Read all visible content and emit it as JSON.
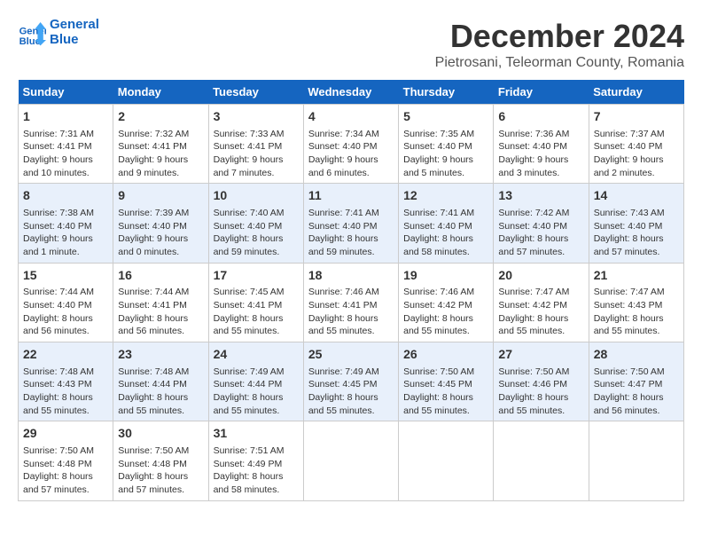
{
  "header": {
    "logo_line1": "General",
    "logo_line2": "Blue",
    "title": "December 2024",
    "subtitle": "Pietrosani, Teleorman County, Romania"
  },
  "weekdays": [
    "Sunday",
    "Monday",
    "Tuesday",
    "Wednesday",
    "Thursday",
    "Friday",
    "Saturday"
  ],
  "weeks": [
    [
      {
        "day": "1",
        "text": "Sunrise: 7:31 AM\nSunset: 4:41 PM\nDaylight: 9 hours and 10 minutes."
      },
      {
        "day": "2",
        "text": "Sunrise: 7:32 AM\nSunset: 4:41 PM\nDaylight: 9 hours and 9 minutes."
      },
      {
        "day": "3",
        "text": "Sunrise: 7:33 AM\nSunset: 4:41 PM\nDaylight: 9 hours and 7 minutes."
      },
      {
        "day": "4",
        "text": "Sunrise: 7:34 AM\nSunset: 4:40 PM\nDaylight: 9 hours and 6 minutes."
      },
      {
        "day": "5",
        "text": "Sunrise: 7:35 AM\nSunset: 4:40 PM\nDaylight: 9 hours and 5 minutes."
      },
      {
        "day": "6",
        "text": "Sunrise: 7:36 AM\nSunset: 4:40 PM\nDaylight: 9 hours and 3 minutes."
      },
      {
        "day": "7",
        "text": "Sunrise: 7:37 AM\nSunset: 4:40 PM\nDaylight: 9 hours and 2 minutes."
      }
    ],
    [
      {
        "day": "8",
        "text": "Sunrise: 7:38 AM\nSunset: 4:40 PM\nDaylight: 9 hours and 1 minute."
      },
      {
        "day": "9",
        "text": "Sunrise: 7:39 AM\nSunset: 4:40 PM\nDaylight: 9 hours and 0 minutes."
      },
      {
        "day": "10",
        "text": "Sunrise: 7:40 AM\nSunset: 4:40 PM\nDaylight: 8 hours and 59 minutes."
      },
      {
        "day": "11",
        "text": "Sunrise: 7:41 AM\nSunset: 4:40 PM\nDaylight: 8 hours and 59 minutes."
      },
      {
        "day": "12",
        "text": "Sunrise: 7:41 AM\nSunset: 4:40 PM\nDaylight: 8 hours and 58 minutes."
      },
      {
        "day": "13",
        "text": "Sunrise: 7:42 AM\nSunset: 4:40 PM\nDaylight: 8 hours and 57 minutes."
      },
      {
        "day": "14",
        "text": "Sunrise: 7:43 AM\nSunset: 4:40 PM\nDaylight: 8 hours and 57 minutes."
      }
    ],
    [
      {
        "day": "15",
        "text": "Sunrise: 7:44 AM\nSunset: 4:40 PM\nDaylight: 8 hours and 56 minutes."
      },
      {
        "day": "16",
        "text": "Sunrise: 7:44 AM\nSunset: 4:41 PM\nDaylight: 8 hours and 56 minutes."
      },
      {
        "day": "17",
        "text": "Sunrise: 7:45 AM\nSunset: 4:41 PM\nDaylight: 8 hours and 55 minutes."
      },
      {
        "day": "18",
        "text": "Sunrise: 7:46 AM\nSunset: 4:41 PM\nDaylight: 8 hours and 55 minutes."
      },
      {
        "day": "19",
        "text": "Sunrise: 7:46 AM\nSunset: 4:42 PM\nDaylight: 8 hours and 55 minutes."
      },
      {
        "day": "20",
        "text": "Sunrise: 7:47 AM\nSunset: 4:42 PM\nDaylight: 8 hours and 55 minutes."
      },
      {
        "day": "21",
        "text": "Sunrise: 7:47 AM\nSunset: 4:43 PM\nDaylight: 8 hours and 55 minutes."
      }
    ],
    [
      {
        "day": "22",
        "text": "Sunrise: 7:48 AM\nSunset: 4:43 PM\nDaylight: 8 hours and 55 minutes."
      },
      {
        "day": "23",
        "text": "Sunrise: 7:48 AM\nSunset: 4:44 PM\nDaylight: 8 hours and 55 minutes."
      },
      {
        "day": "24",
        "text": "Sunrise: 7:49 AM\nSunset: 4:44 PM\nDaylight: 8 hours and 55 minutes."
      },
      {
        "day": "25",
        "text": "Sunrise: 7:49 AM\nSunset: 4:45 PM\nDaylight: 8 hours and 55 minutes."
      },
      {
        "day": "26",
        "text": "Sunrise: 7:50 AM\nSunset: 4:45 PM\nDaylight: 8 hours and 55 minutes."
      },
      {
        "day": "27",
        "text": "Sunrise: 7:50 AM\nSunset: 4:46 PM\nDaylight: 8 hours and 55 minutes."
      },
      {
        "day": "28",
        "text": "Sunrise: 7:50 AM\nSunset: 4:47 PM\nDaylight: 8 hours and 56 minutes."
      }
    ],
    [
      {
        "day": "29",
        "text": "Sunrise: 7:50 AM\nSunset: 4:48 PM\nDaylight: 8 hours and 57 minutes."
      },
      {
        "day": "30",
        "text": "Sunrise: 7:50 AM\nSunset: 4:48 PM\nDaylight: 8 hours and 57 minutes."
      },
      {
        "day": "31",
        "text": "Sunrise: 7:51 AM\nSunset: 4:49 PM\nDaylight: 8 hours and 58 minutes."
      },
      null,
      null,
      null,
      null
    ]
  ]
}
